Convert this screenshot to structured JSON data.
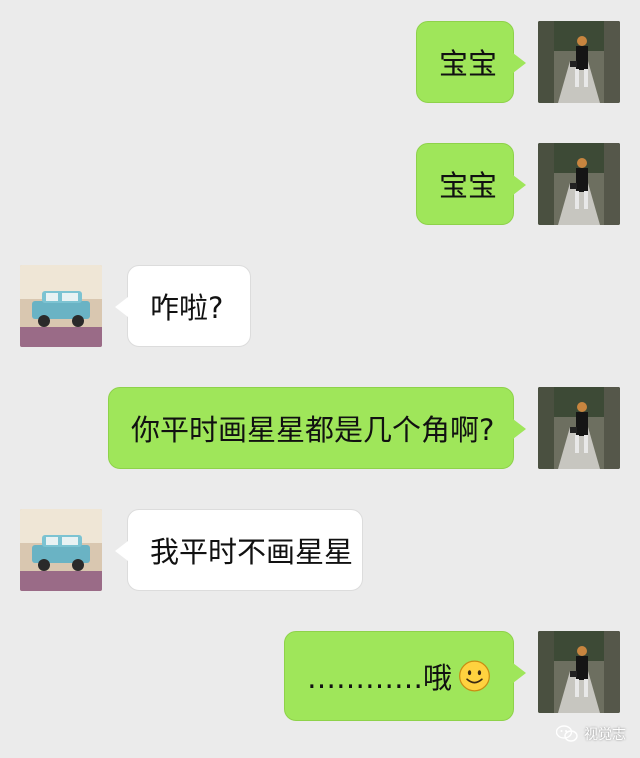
{
  "messages": [
    {
      "side": "me",
      "text": "宝宝",
      "avatar": "girl-photo-avatar"
    },
    {
      "side": "me",
      "text": "宝宝",
      "avatar": "girl-photo-avatar"
    },
    {
      "side": "them",
      "text": "咋啦?",
      "avatar": "toy-car-avatar"
    },
    {
      "side": "me",
      "text": "你平时画星星都是几个角啊?",
      "avatar": "girl-photo-avatar"
    },
    {
      "side": "them",
      "text": "我平时不画星星",
      "avatar": "toy-car-avatar"
    },
    {
      "side": "me",
      "text": "…………哦",
      "avatar": "girl-photo-avatar",
      "emoji": "smiley-emoji"
    }
  ],
  "watermark": {
    "text": "视觉志",
    "icon": "wechat-icon"
  },
  "colors": {
    "background": "#ebebeb",
    "outgoing_bubble": "#9fe65a",
    "incoming_bubble": "#ffffff"
  }
}
